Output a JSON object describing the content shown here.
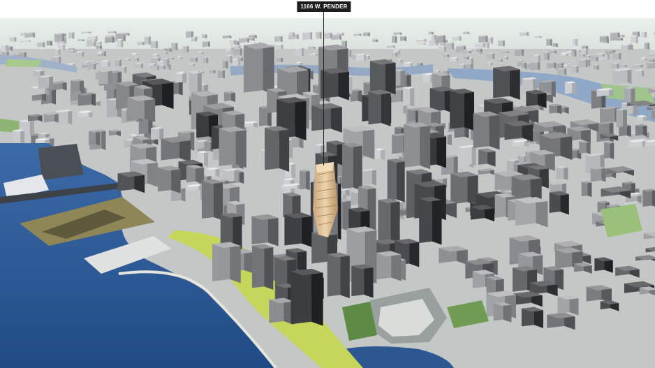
{
  "callout": {
    "label": "1166 W. PENDER"
  },
  "colors": {
    "water": "#2e5d9b",
    "ground": "#c8cbc9",
    "park": "#b9cf55",
    "tower_highlight": "#d7b98d",
    "sky": "#e6ede9"
  }
}
